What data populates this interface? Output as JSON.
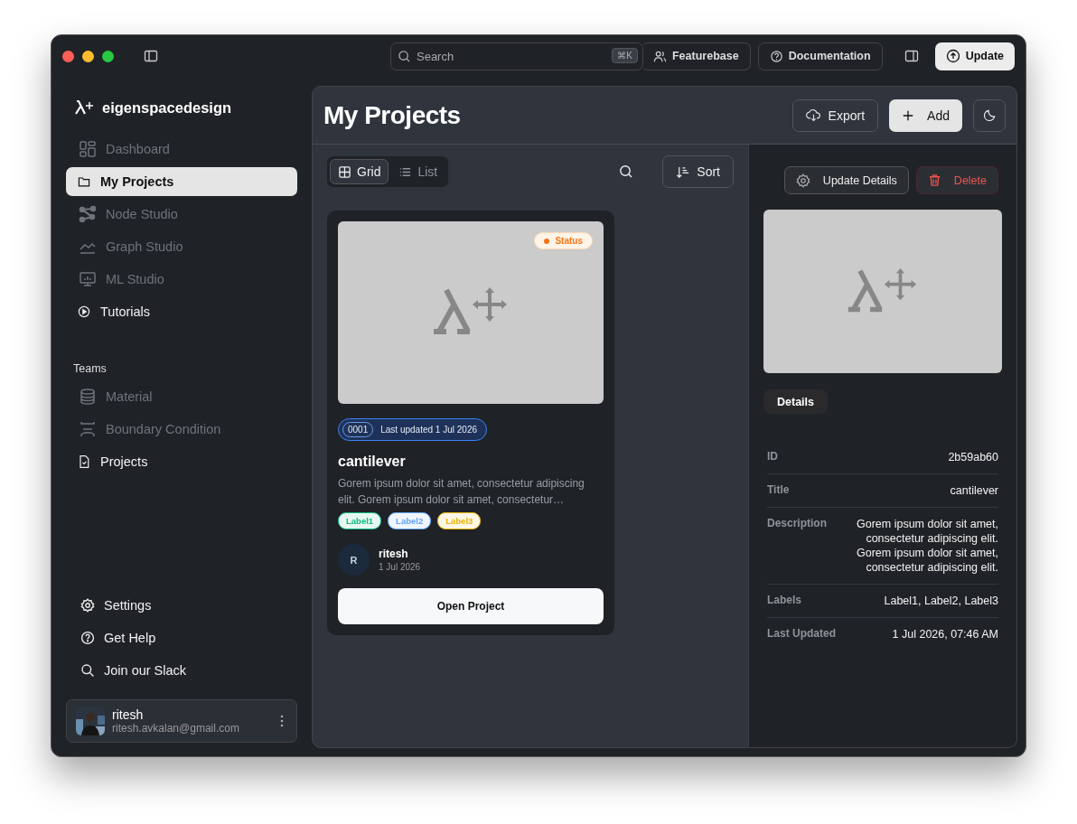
{
  "titlebar": {
    "search": {
      "placeholder": "Search",
      "shortcut": "⌘K"
    },
    "buttons": [
      {
        "label": "Featurebase"
      },
      {
        "label": "Documentation"
      }
    ],
    "update_button": "Update"
  },
  "sidebar": {
    "brand": "eigenspacedesign",
    "items": [
      {
        "label": "Dashboard",
        "selected": false,
        "disabled": true
      },
      {
        "label": "My Projects",
        "selected": true,
        "disabled": false
      },
      {
        "label": "Node Studio",
        "selected": false,
        "disabled": true
      },
      {
        "label": "Graph Studio",
        "selected": false,
        "disabled": true
      },
      {
        "label": "ML Studio",
        "selected": false,
        "disabled": true
      },
      {
        "label": "Tutorials",
        "selected": false,
        "disabled": false
      }
    ],
    "teams": {
      "heading": "Teams",
      "items": [
        {
          "label": "Material",
          "disabled": true
        },
        {
          "label": "Boundary Condition",
          "disabled": true
        },
        {
          "label": "Projects",
          "disabled": false
        }
      ]
    },
    "footer_items": [
      {
        "label": "Settings"
      },
      {
        "label": "Get Help"
      },
      {
        "label": "Join our Slack"
      }
    ],
    "user": {
      "name": "ritesh",
      "email": "ritesh.avkalan@gmail.com"
    }
  },
  "main": {
    "title": "My Projects",
    "export": "Export",
    "add": "Add",
    "view_toggle": [
      {
        "label": "Grid",
        "selected": true
      },
      {
        "label": "List",
        "selected": false
      }
    ],
    "sort": "Sort",
    "project_card": {
      "status": "Status",
      "number": "0001",
      "updated": "Last updated 1 Jul 2026",
      "title": "cantilever",
      "description": "Gorem ipsum dolor sit amet, consectetur adipiscing elit. Gorem ipsum dolor sit amet, consectetur…",
      "labels": [
        {
          "text": "Label1",
          "color": "#10b981"
        },
        {
          "text": "Label2",
          "color": "#60a5fa"
        },
        {
          "text": "Label3",
          "color": "#eab308"
        }
      ],
      "author_initial": "R",
      "author": "ritesh",
      "date": "1 Jul 2026",
      "open_button": "Open Project"
    },
    "details": {
      "update_button": "Update Details",
      "delete_button": "Delete",
      "tabs": [
        {
          "label": "Details",
          "selected": true
        }
      ],
      "rows": [
        {
          "label": "ID",
          "value": "2b59ab60"
        },
        {
          "label": "Title",
          "value": "cantilever"
        },
        {
          "label": "Description",
          "value": "Gorem ipsum dolor sit amet, consectetur adipiscing elit. Gorem ipsum dolor sit amet, consectetur adipiscing elit."
        },
        {
          "label": "Labels",
          "value": "Label1, Label2, Label3"
        },
        {
          "label": "Last Updated",
          "value": "1 Jul 2026, 07:46 AM"
        }
      ]
    }
  }
}
